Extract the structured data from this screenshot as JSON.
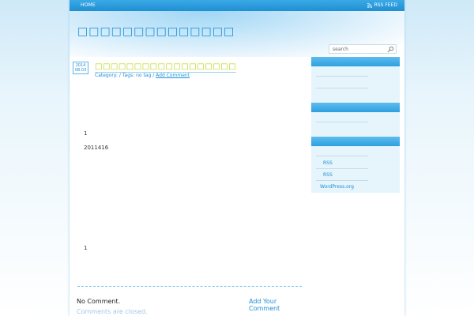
{
  "nav": {
    "home_label": "HOME",
    "rss_label": "RSS FEED"
  },
  "header": {
    "site_title": "□□□□□□□□□□□□□□"
  },
  "search": {
    "placeholder": "search"
  },
  "post": {
    "date_year": "2014",
    "date_md": "08.03",
    "title": "□□□□□□□□□□□□□□□□□□",
    "meta_category": "Category:",
    "meta_tags": "/ Tags: no tag /",
    "meta_add_comment": "Add Comment",
    "body_line1": "1",
    "body_line2": "2011416",
    "body_line3": "1"
  },
  "comments": {
    "no_comment": "No Comment.",
    "add_your_comment": "Add Your Comment",
    "closed": "Comments are closed."
  },
  "sidebar": {
    "links": [
      "RSS",
      "RSS",
      "WordPress.org"
    ]
  },
  "colors": {
    "accent": "#1a8fd8",
    "title_green": "#b7d30a",
    "bar_blue": "#2ea0e0"
  }
}
